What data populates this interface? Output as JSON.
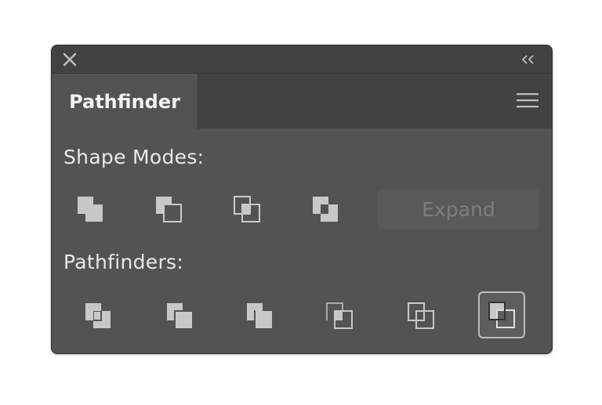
{
  "panel": {
    "tab_label": "Pathfinder",
    "shape_modes_label": "Shape Modes:",
    "pathfinders_label": "Pathfinders:",
    "expand_label": "Expand"
  },
  "shape_modes": [
    {
      "name": "unite",
      "icon": "unite-icon"
    },
    {
      "name": "minus-front",
      "icon": "minus-front-icon"
    },
    {
      "name": "intersect",
      "icon": "intersect-icon"
    },
    {
      "name": "exclude",
      "icon": "exclude-icon"
    }
  ],
  "pathfinders": [
    {
      "name": "divide",
      "icon": "divide-icon"
    },
    {
      "name": "trim",
      "icon": "trim-icon"
    },
    {
      "name": "merge",
      "icon": "merge-icon"
    },
    {
      "name": "crop",
      "icon": "crop-icon"
    },
    {
      "name": "outline",
      "icon": "outline-icon"
    },
    {
      "name": "minus-back",
      "icon": "minus-back-icon",
      "selected": true
    }
  ],
  "colors": {
    "panel_bg": "#535353",
    "titlebar_bg": "#424242",
    "icon_fill": "#c8c8c8",
    "text": "#e9e9e9",
    "disabled_text": "#7d7d7d"
  }
}
